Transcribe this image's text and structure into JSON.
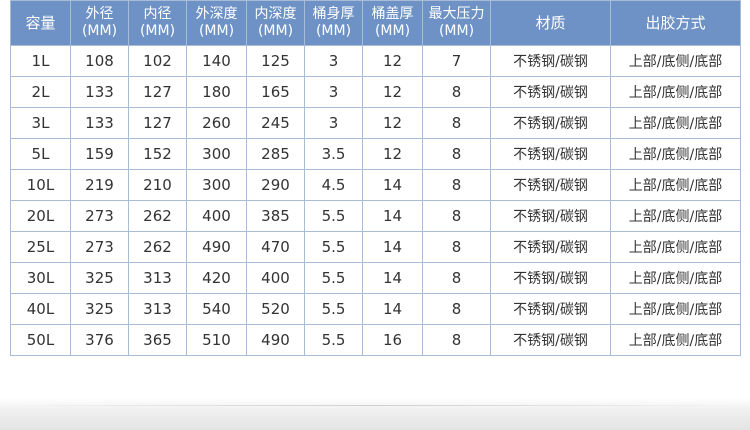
{
  "headers": [
    {
      "l1": "容量",
      "l2": ""
    },
    {
      "l1": "外径",
      "l2": "(MM)"
    },
    {
      "l1": "内径",
      "l2": "(MM)"
    },
    {
      "l1": "外深度",
      "l2": "(MM)"
    },
    {
      "l1": "内深度",
      "l2": "(MM)"
    },
    {
      "l1": "桶身厚",
      "l2": "(MM)"
    },
    {
      "l1": "桶盖厚",
      "l2": "(MM)"
    },
    {
      "l1": "最大压力",
      "l2": "(MM)"
    },
    {
      "l1": "材质",
      "l2": ""
    },
    {
      "l1": "出胶方式",
      "l2": ""
    }
  ],
  "rows": [
    [
      "1L",
      "108",
      "102",
      "140",
      "125",
      "3",
      "12",
      "7",
      "不锈钢/碳钢",
      "上部/底侧/底部"
    ],
    [
      "2L",
      "133",
      "127",
      "180",
      "165",
      "3",
      "12",
      "8",
      "不锈钢/碳钢",
      "上部/底侧/底部"
    ],
    [
      "3L",
      "133",
      "127",
      "260",
      "245",
      "3",
      "12",
      "8",
      "不锈钢/碳钢",
      "上部/底侧/底部"
    ],
    [
      "5L",
      "159",
      "152",
      "300",
      "285",
      "3.5",
      "12",
      "8",
      "不锈钢/碳钢",
      "上部/底侧/底部"
    ],
    [
      "10L",
      "219",
      "210",
      "300",
      "290",
      "4.5",
      "14",
      "8",
      "不锈钢/碳钢",
      "上部/底侧/底部"
    ],
    [
      "20L",
      "273",
      "262",
      "400",
      "385",
      "5.5",
      "14",
      "8",
      "不锈钢/碳钢",
      "上部/底侧/底部"
    ],
    [
      "25L",
      "273",
      "262",
      "490",
      "470",
      "5.5",
      "14",
      "8",
      "不锈钢/碳钢",
      "上部/底侧/底部"
    ],
    [
      "30L",
      "325",
      "313",
      "420",
      "400",
      "5.5",
      "14",
      "8",
      "不锈钢/碳钢",
      "上部/底侧/底部"
    ],
    [
      "40L",
      "325",
      "313",
      "540",
      "520",
      "5.5",
      "14",
      "8",
      "不锈钢/碳钢",
      "上部/底侧/底部"
    ],
    [
      "50L",
      "376",
      "365",
      "510",
      "490",
      "5.5",
      "16",
      "8",
      "不锈钢/碳钢",
      "上部/底侧/底部"
    ]
  ],
  "colors": {
    "header_bg": "#6e92c5",
    "header_text": "#ffffff",
    "border": "#a9bcd6",
    "cell_text": "#333333"
  }
}
